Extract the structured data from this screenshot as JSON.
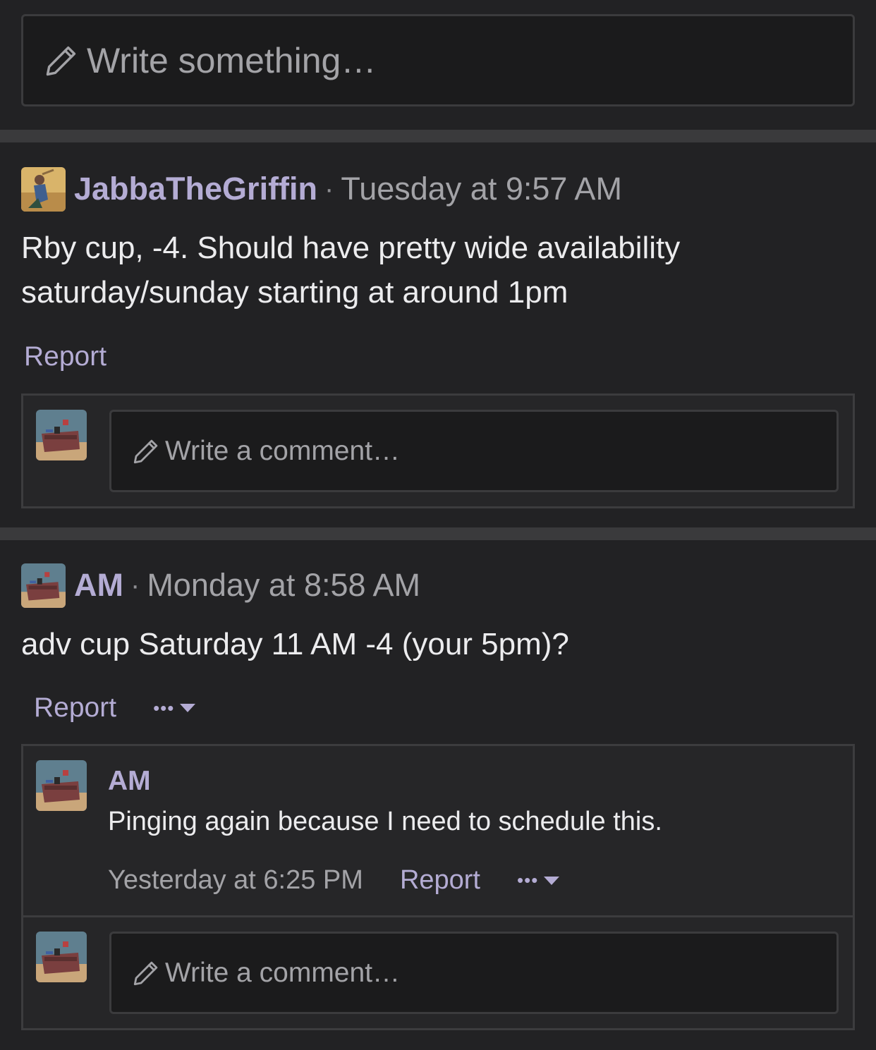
{
  "composer": {
    "placeholder": "Write something…",
    "icon": "pencil-icon"
  },
  "posts": [
    {
      "author": "JabbaTheGriffin",
      "separator": "·",
      "timestamp": "Tuesday at 9:57 AM",
      "body_lines": [
        "Rby cup, -4. Should have pretty wide availability",
        "saturday/sunday starting at around 1pm"
      ],
      "report_label": "Report",
      "comment_placeholder": "Write a comment…"
    },
    {
      "author": "AM",
      "separator": "·",
      "timestamp": "Monday at 8:58 AM",
      "body": "adv cup Saturday 11 AM -4 (your 5pm)?",
      "report_label": "Report",
      "more_label": "•••",
      "reply": {
        "author": "AM",
        "text": "Pinging again because I need to schedule this.",
        "timestamp": "Yesterday at 6:25 PM",
        "report_label": "Report",
        "more_label": "•••"
      },
      "comment_placeholder": "Write a comment…"
    }
  ],
  "colors": {
    "accent": "#b4acd4",
    "background": "#222224",
    "input_bg": "#1b1b1c"
  }
}
